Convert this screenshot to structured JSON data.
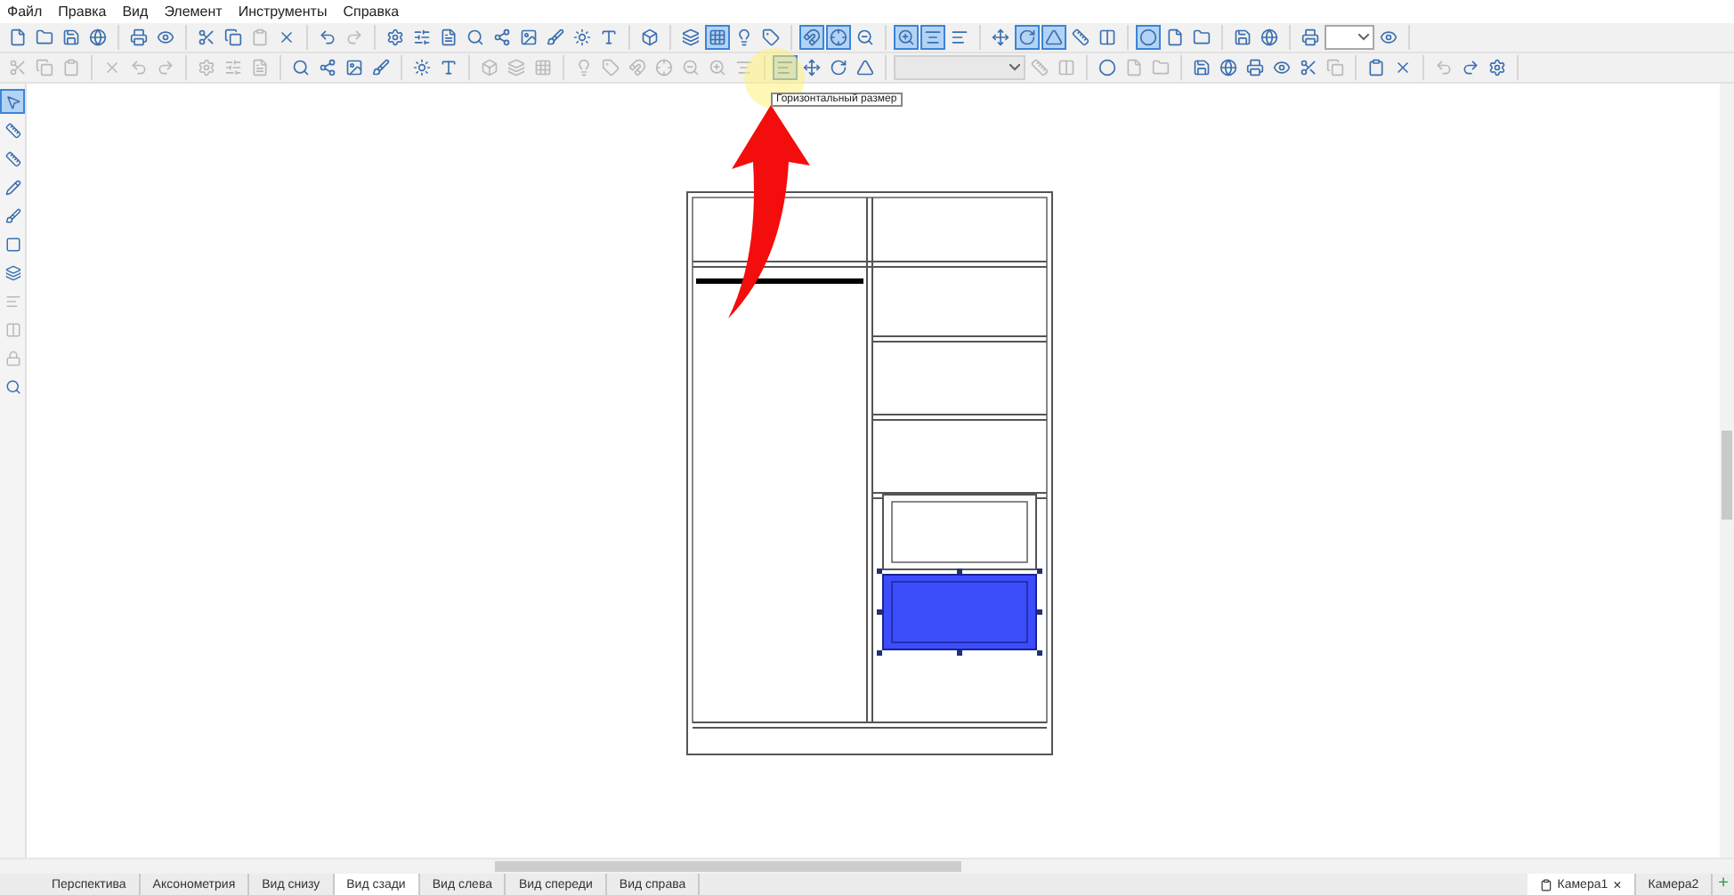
{
  "menu": [
    {
      "label": "Файл"
    },
    {
      "label": "Правка"
    },
    {
      "label": "Вид"
    },
    {
      "label": "Элемент"
    },
    {
      "label": "Инструменты"
    },
    {
      "label": "Справка"
    }
  ],
  "toolbars": [
    {
      "groups": [
        {
          "items": [
            {
              "kind": "button",
              "pressed": false,
              "disabled": false
            },
            {
              "kind": "button",
              "pressed": false,
              "disabled": false
            },
            {
              "kind": "button",
              "pressed": false,
              "disabled": false
            },
            {
              "kind": "button",
              "pressed": false,
              "disabled": false
            }
          ]
        },
        {
          "items": [
            {
              "kind": "button",
              "pressed": false,
              "disabled": false
            },
            {
              "kind": "button",
              "pressed": false,
              "disabled": false
            }
          ]
        },
        {
          "items": [
            {
              "kind": "button",
              "pressed": false,
              "disabled": false
            },
            {
              "kind": "button",
              "pressed": false,
              "disabled": false
            },
            {
              "kind": "button",
              "pressed": false,
              "disabled": true
            },
            {
              "kind": "button",
              "pressed": false,
              "disabled": false
            }
          ]
        },
        {
          "items": [
            {
              "kind": "button",
              "pressed": false,
              "disabled": false
            },
            {
              "kind": "button",
              "pressed": false,
              "disabled": true
            }
          ]
        },
        {
          "items": [
            {
              "kind": "button",
              "pressed": false,
              "disabled": false
            },
            {
              "kind": "button",
              "pressed": false,
              "disabled": false
            },
            {
              "kind": "button",
              "pressed": false,
              "disabled": false
            },
            {
              "kind": "button",
              "pressed": false,
              "disabled": false
            },
            {
              "kind": "button",
              "pressed": false,
              "disabled": false
            },
            {
              "kind": "button",
              "pressed": false,
              "disabled": false
            },
            {
              "kind": "button",
              "pressed": false,
              "disabled": false
            },
            {
              "kind": "button",
              "pressed": false,
              "disabled": false
            },
            {
              "kind": "button",
              "pressed": false,
              "disabled": false
            }
          ]
        },
        {
          "items": [
            {
              "kind": "button",
              "pressed": false,
              "disabled": false
            }
          ]
        },
        {
          "items": [
            {
              "kind": "button",
              "pressed": false,
              "disabled": false
            },
            {
              "kind": "button",
              "pressed": true,
              "disabled": false
            },
            {
              "kind": "button",
              "pressed": false,
              "disabled": false
            },
            {
              "kind": "button",
              "pressed": false,
              "disabled": false
            }
          ]
        },
        {
          "items": [
            {
              "kind": "button",
              "pressed": true,
              "disabled": false
            },
            {
              "kind": "button",
              "pressed": true,
              "disabled": false
            },
            {
              "kind": "button",
              "pressed": false,
              "disabled": false
            }
          ]
        },
        {
          "items": [
            {
              "kind": "button",
              "pressed": true,
              "disabled": false
            },
            {
              "kind": "button",
              "pressed": true,
              "disabled": false
            },
            {
              "kind": "button",
              "pressed": false,
              "disabled": false
            }
          ]
        },
        {
          "items": [
            {
              "kind": "button",
              "pressed": false,
              "disabled": false
            },
            {
              "kind": "button",
              "pressed": true,
              "disabled": false
            },
            {
              "kind": "button",
              "pressed": true,
              "disabled": false
            },
            {
              "kind": "button",
              "pressed": false,
              "disabled": false
            },
            {
              "kind": "button",
              "pressed": false,
              "disabled": false
            }
          ]
        },
        {
          "items": [
            {
              "kind": "button",
              "pressed": true,
              "disabled": false
            },
            {
              "kind": "button",
              "pressed": false,
              "disabled": false
            },
            {
              "kind": "button",
              "pressed": false,
              "disabled": false
            }
          ]
        },
        {
          "items": [
            {
              "kind": "button",
              "pressed": false,
              "disabled": false
            },
            {
              "kind": "button",
              "pressed": false,
              "disabled": false
            }
          ]
        },
        {
          "items": [
            {
              "kind": "button",
              "pressed": false,
              "disabled": false
            },
            {
              "kind": "combo",
              "disabled": false
            },
            {
              "kind": "button",
              "pressed": false,
              "disabled": false
            }
          ]
        }
      ]
    },
    {
      "groups": [
        {
          "items": [
            {
              "kind": "button",
              "pressed": false,
              "disabled": true
            },
            {
              "kind": "button",
              "pressed": false,
              "disabled": true
            },
            {
              "kind": "button",
              "pressed": false,
              "disabled": true
            }
          ]
        },
        {
          "items": [
            {
              "kind": "button",
              "pressed": false,
              "disabled": true
            },
            {
              "kind": "button",
              "pressed": false,
              "disabled": true
            },
            {
              "kind": "button",
              "pressed": false,
              "disabled": true
            }
          ]
        },
        {
          "items": [
            {
              "kind": "button",
              "pressed": false,
              "disabled": true
            },
            {
              "kind": "button",
              "pressed": false,
              "disabled": true
            },
            {
              "kind": "button",
              "pressed": false,
              "disabled": true
            }
          ]
        },
        {
          "items": [
            {
              "kind": "button",
              "pressed": false,
              "disabled": false
            },
            {
              "kind": "button",
              "pressed": false,
              "disabled": false
            },
            {
              "kind": "button",
              "pressed": false,
              "disabled": false
            },
            {
              "kind": "button",
              "pressed": false,
              "disabled": false
            }
          ]
        },
        {
          "items": [
            {
              "kind": "button",
              "pressed": false,
              "disabled": false
            },
            {
              "kind": "button",
              "pressed": false,
              "disabled": false
            }
          ]
        },
        {
          "items": [
            {
              "kind": "button",
              "pressed": false,
              "disabled": true
            },
            {
              "kind": "button",
              "pressed": false,
              "disabled": true
            },
            {
              "kind": "button",
              "pressed": false,
              "disabled": true
            }
          ]
        },
        {
          "items": [
            {
              "kind": "button",
              "pressed": false,
              "disabled": true
            },
            {
              "kind": "button",
              "pressed": false,
              "disabled": true
            },
            {
              "kind": "button",
              "pressed": false,
              "disabled": true
            },
            {
              "kind": "button",
              "pressed": false,
              "disabled": true
            },
            {
              "kind": "button",
              "pressed": false,
              "disabled": true
            },
            {
              "kind": "button",
              "pressed": false,
              "disabled": true
            },
            {
              "kind": "button",
              "pressed": false,
              "disabled": true
            }
          ]
        },
        {
          "items": [
            {
              "kind": "button",
              "pressed": true,
              "disabled": false
            },
            {
              "kind": "button",
              "pressed": false,
              "disabled": false
            },
            {
              "kind": "button",
              "pressed": false,
              "disabled": false
            },
            {
              "kind": "button",
              "pressed": false,
              "disabled": false
            }
          ]
        },
        {
          "items": [
            {
              "kind": "combo",
              "disabled": true
            },
            {
              "kind": "button",
              "pressed": false,
              "disabled": true
            },
            {
              "kind": "button",
              "pressed": false,
              "disabled": true
            }
          ]
        },
        {
          "items": [
            {
              "kind": "button",
              "pressed": false,
              "disabled": false
            },
            {
              "kind": "button",
              "pressed": false,
              "disabled": true
            },
            {
              "kind": "button",
              "pressed": false,
              "disabled": true
            }
          ]
        },
        {
          "items": [
            {
              "kind": "button",
              "pressed": false,
              "disabled": false
            },
            {
              "kind": "button",
              "pressed": false,
              "disabled": false
            },
            {
              "kind": "button",
              "pressed": false,
              "disabled": false
            },
            {
              "kind": "button",
              "pressed": false,
              "disabled": false
            },
            {
              "kind": "button",
              "pressed": false,
              "disabled": false
            },
            {
              "kind": "button",
              "pressed": false,
              "disabled": true
            }
          ]
        },
        {
          "items": [
            {
              "kind": "button",
              "pressed": false,
              "disabled": false
            },
            {
              "kind": "button",
              "pressed": false,
              "disabled": false
            }
          ]
        },
        {
          "items": [
            {
              "kind": "button",
              "pressed": false,
              "disabled": true
            },
            {
              "kind": "button",
              "pressed": false,
              "disabled": false
            },
            {
              "kind": "button",
              "pressed": false,
              "disabled": false
            }
          ]
        }
      ]
    }
  ],
  "tooltip": "Горизонтальный размер",
  "left_tools": [
    {
      "pressed": true,
      "disabled": false
    },
    {
      "pressed": false,
      "disabled": false
    },
    {
      "pressed": false,
      "disabled": false
    },
    {
      "pressed": false,
      "disabled": false
    },
    {
      "pressed": false,
      "disabled": false
    },
    {
      "pressed": false,
      "disabled": false
    },
    {
      "pressed": false,
      "disabled": false
    },
    {
      "pressed": false,
      "disabled": true
    },
    {
      "pressed": false,
      "disabled": true
    },
    {
      "pressed": false,
      "disabled": true
    },
    {
      "pressed": false,
      "disabled": false
    }
  ],
  "drawers": [
    {
      "selected": false
    },
    {
      "selected": true
    }
  ],
  "view_tabs": [
    {
      "label": "Перспектива",
      "selected": false
    },
    {
      "label": "Аксонометрия",
      "selected": false
    },
    {
      "label": "Вид снизу",
      "selected": false
    },
    {
      "label": "Вид сзади",
      "selected": true
    },
    {
      "label": "Вид слева",
      "selected": false
    },
    {
      "label": "Вид спереди",
      "selected": false
    },
    {
      "label": "Вид справа",
      "selected": false
    }
  ],
  "camera_tabs": [
    {
      "label": "Камера1",
      "selected": true,
      "close": "×"
    },
    {
      "label": "Камера2",
      "selected": false
    }
  ],
  "add_tab": "+"
}
